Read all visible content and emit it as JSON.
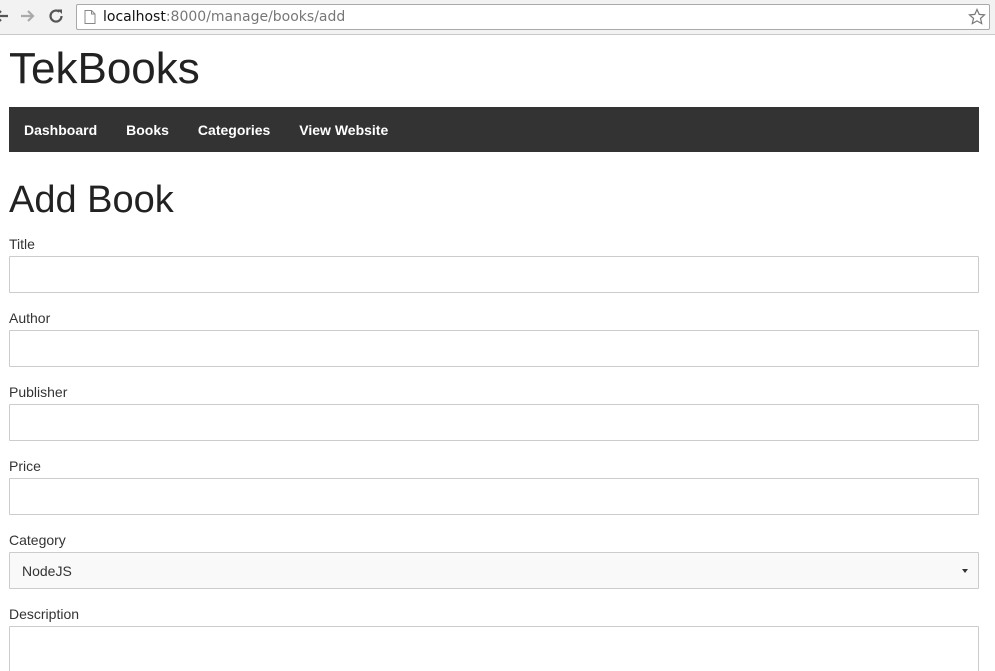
{
  "browser": {
    "url_host": "localhost",
    "url_rest": ":8000/manage/books/add"
  },
  "site": {
    "brand": "TekBooks"
  },
  "nav": {
    "items": [
      {
        "label": "Dashboard"
      },
      {
        "label": "Books"
      },
      {
        "label": "Categories"
      },
      {
        "label": "View Website"
      }
    ]
  },
  "page": {
    "heading": "Add Book"
  },
  "form": {
    "title": {
      "label": "Title",
      "value": ""
    },
    "author": {
      "label": "Author",
      "value": ""
    },
    "publisher": {
      "label": "Publisher",
      "value": ""
    },
    "price": {
      "label": "Price",
      "value": ""
    },
    "category": {
      "label": "Category",
      "selected": "NodeJS"
    },
    "description": {
      "label": "Description",
      "value": ""
    }
  }
}
